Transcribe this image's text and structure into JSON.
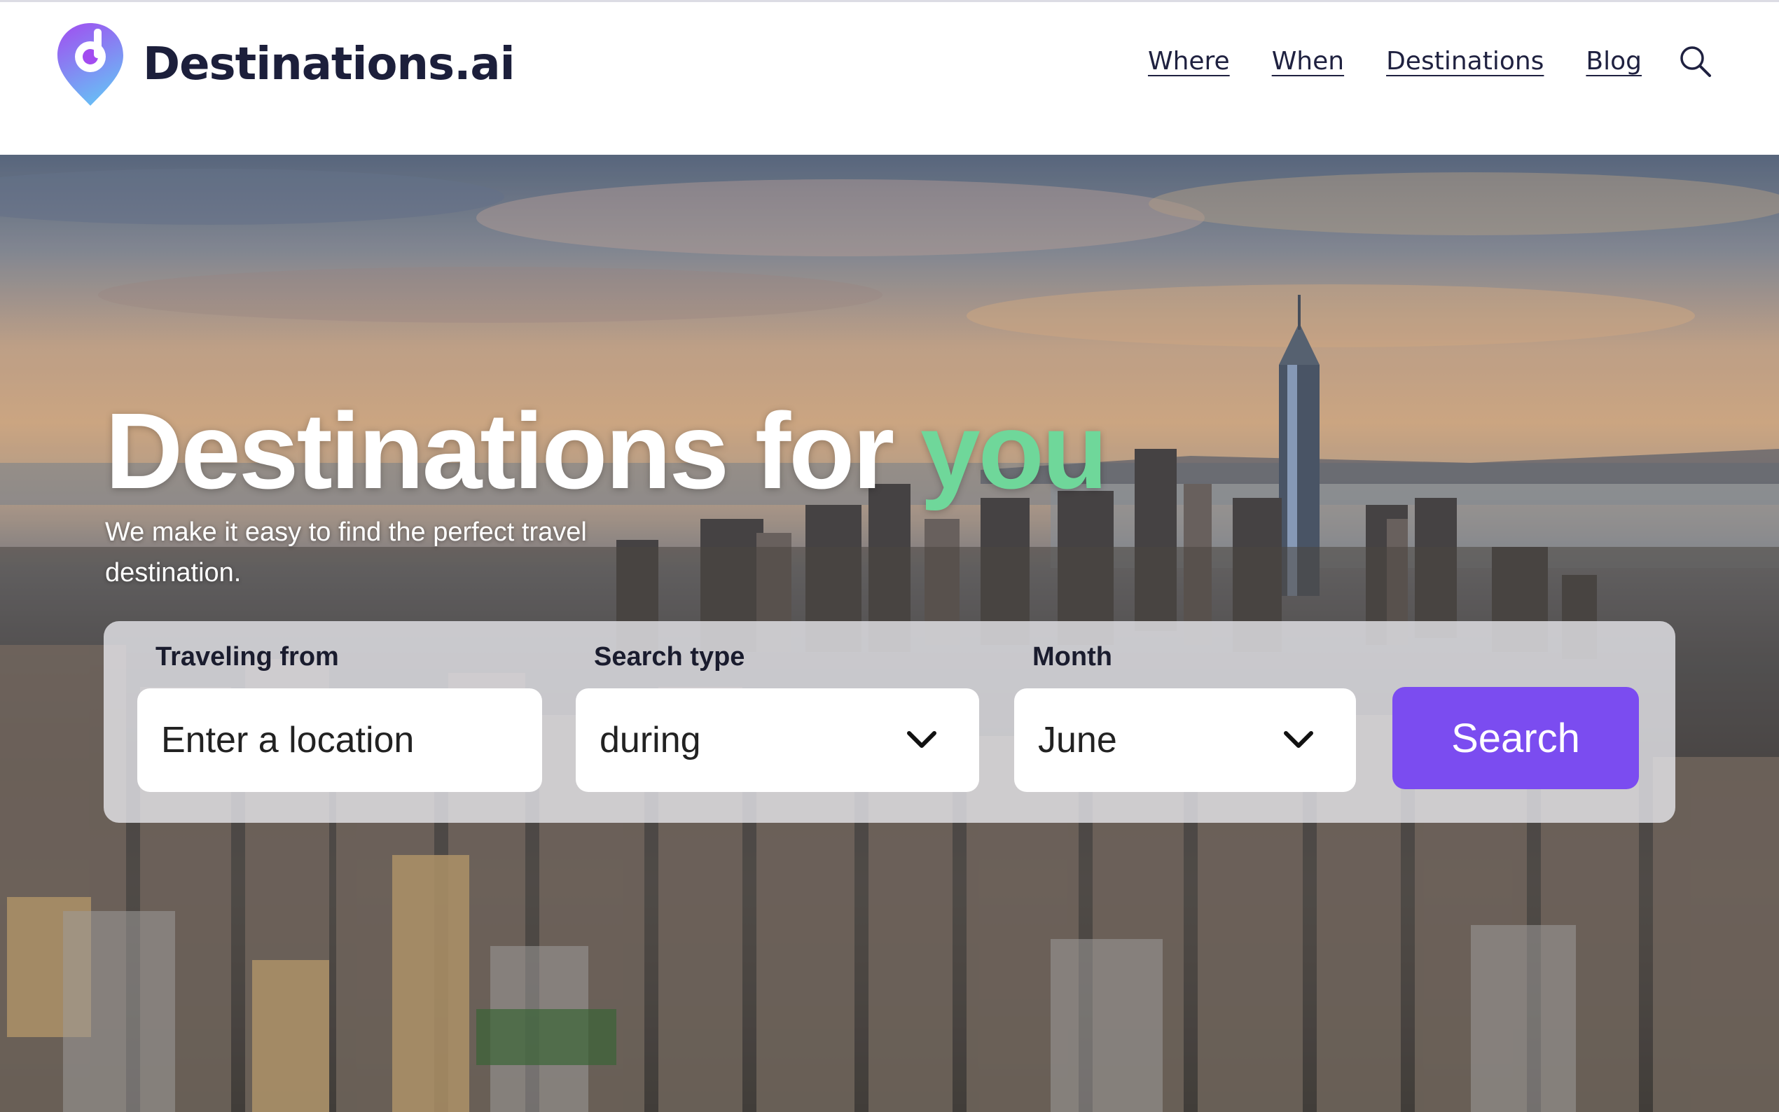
{
  "brand": {
    "name": "Destinations.ai",
    "logo_icon": "location-pin-logo-icon",
    "logo_colors": {
      "top": "#a24cf0",
      "bottom": "#6bb8f5"
    }
  },
  "nav": {
    "items": [
      {
        "label": "Where"
      },
      {
        "label": "When"
      },
      {
        "label": "Destinations"
      },
      {
        "label": "Blog"
      }
    ],
    "search_icon": "search-icon"
  },
  "hero": {
    "title_main": "Destinations for",
    "title_accent": "you",
    "accent_color": "#6fd79a",
    "subtitle": "We make it easy to find the perfect travel destination.",
    "background": "aerial-city-skyline-sunset"
  },
  "search_form": {
    "from": {
      "label": "Traveling from",
      "placeholder": "Enter a location",
      "value": ""
    },
    "search_type": {
      "label": "Search type",
      "selected": "during"
    },
    "month": {
      "label": "Month",
      "selected": "June"
    },
    "submit_label": "Search",
    "submit_color": "#7b4cf0"
  }
}
